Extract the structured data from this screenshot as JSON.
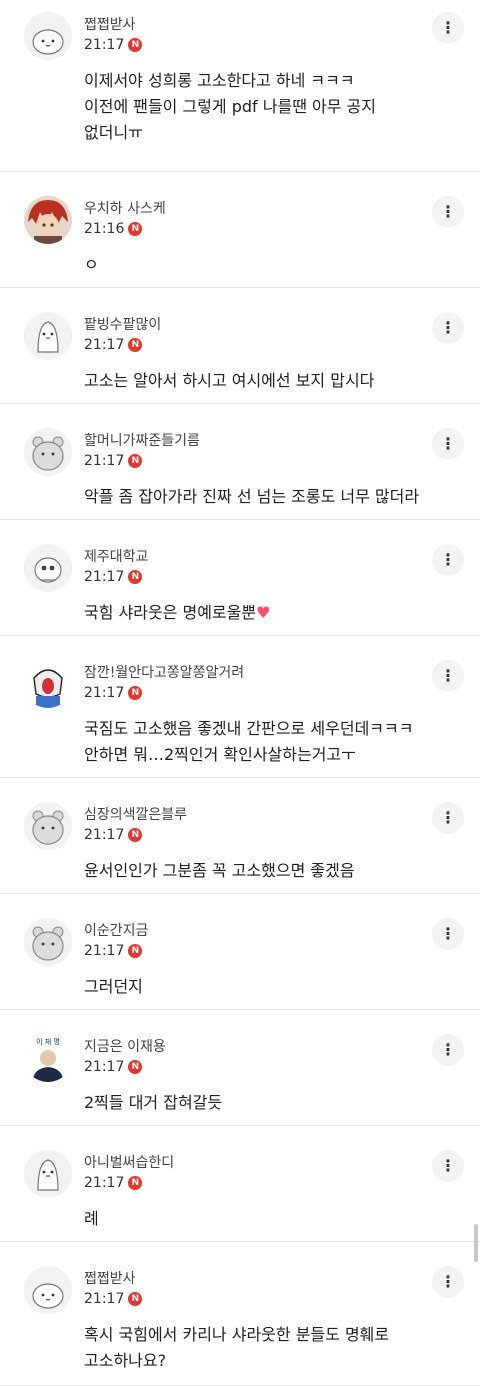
{
  "comments": [
    {
      "username": "쩝쩝받사",
      "time": "21:17",
      "badge": "N",
      "text": "이제서야 성희롱 고소한다고 하네 ㅋㅋㅋ\n이전에 팬들이 그렇게 pdf 나를땐 아무 공지\n없더니ㅠ",
      "avatar_icon": "cute-bunny-avatar-icon"
    },
    {
      "username": "우치하 사스케",
      "time": "21:16",
      "badge": "N",
      "text": "ㅇ",
      "avatar_icon": "red-hair-character-avatar-icon"
    },
    {
      "username": "팥빙수팥많이",
      "time": "21:17",
      "badge": "N",
      "text": "고소는 알아서 하시고 여시에선 보지 맙시다",
      "avatar_icon": "penguin-avatar-icon"
    },
    {
      "username": "할머니가짜준들기름",
      "time": "21:17",
      "badge": "N",
      "text": "악플 좀 잡아가라 진짜 선 넘는 조롱도 너무 많더라",
      "avatar_icon": "bear-avatar-icon"
    },
    {
      "username": "제주대학교",
      "time": "21:17",
      "badge": "N",
      "text": "국힘 샤라웃은 명예로울뿐",
      "avatar_icon": "bee-avatar-icon",
      "heart": "♥"
    },
    {
      "username": "잠깐!월안다고쫑알쫑알거려",
      "time": "21:17",
      "badge": "N",
      "text": "국짐도 고소했음 좋겠내 간판으로 세우던데ㅋㅋㅋ\n안하면 뭐…2찍인거 확인사살하는거고ㅜ",
      "avatar_icon": "screaming-cartoon-avatar-icon"
    },
    {
      "username": "심장의색깔은블루",
      "time": "21:17",
      "badge": "N",
      "text": "윤서인인가 그분좀 꼭 고소했으면 좋겠음",
      "avatar_icon": "bear-avatar-icon"
    },
    {
      "username": "이순간지금",
      "time": "21:17",
      "badge": "N",
      "text": "그러던지",
      "avatar_icon": "bear-avatar-icon"
    },
    {
      "username": "지금은 이재용",
      "time": "21:17",
      "badge": "N",
      "text": "2찍들 대거 잡혀갈듯",
      "avatar_icon": "person-photo-avatar-icon",
      "avatar_caption": "이 재 명"
    },
    {
      "username": "아니벌써습한디",
      "time": "21:17",
      "badge": "N",
      "text": "례",
      "avatar_icon": "penguin-avatar-icon"
    },
    {
      "username": "쩝쩝받사",
      "time": "21:17",
      "badge": "N",
      "text": "혹시 국힘에서 카리나 샤라웃한 분들도 명훼로\n고소하나요?",
      "avatar_icon": "cute-bunny-avatar-icon"
    }
  ],
  "more_glyph": "⋮"
}
